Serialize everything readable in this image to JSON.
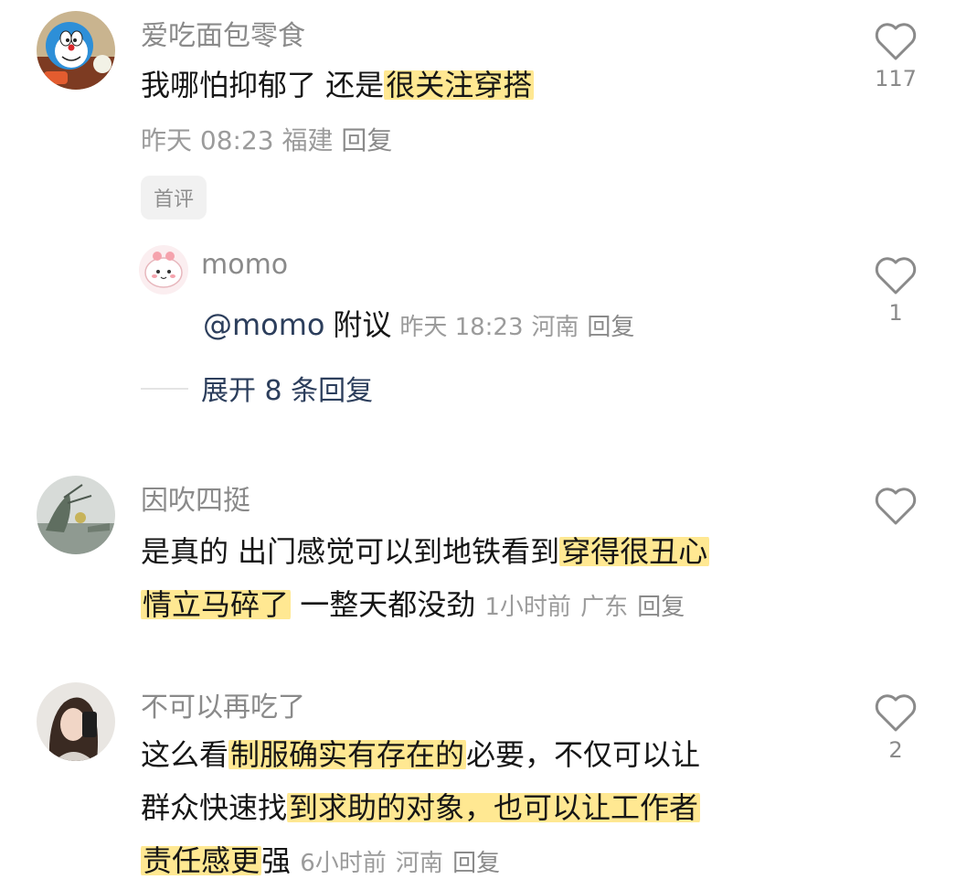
{
  "comments": [
    {
      "username": "爱吃面包零食",
      "text_plain": "我哪怕抑郁了 还是",
      "text_hl": "很关注穿搭",
      "time": "昨天 08:23",
      "location": "福建",
      "reply_label": "回复",
      "badge": "首评",
      "likes": "117",
      "avatar_icon": "doraemon-avatar-icon"
    },
    {
      "username": "因吹四挺",
      "line1_plain": "是真的 出门感觉可以到地铁看到",
      "line1_hl": "穿得很丑心",
      "line2_hl": "情立马碎了",
      "line2_plain": " 一整天都没劲",
      "time": "1小时前",
      "location": "广东",
      "reply_label": "回复",
      "likes": "",
      "avatar_icon": "landscape-avatar-icon"
    },
    {
      "username": "不可以再吃了",
      "line1_plain": "这么看",
      "line1_hl": "制服确实有存在的",
      "line1_tail": "必要，不仅可以让",
      "line2_plain": "群众快速找",
      "line2_hl": "到求助的对象，也可以让工作者",
      "line3_hl": "责任感更",
      "line3_plain": "强",
      "time": "6小时前",
      "location": "河南",
      "reply_label": "回复",
      "likes": "2",
      "avatar_icon": "selfie-avatar-icon"
    }
  ],
  "reply": {
    "username": "momo",
    "mention": "@momo",
    "text": "附议",
    "time": "昨天 18:23",
    "location": "河南",
    "reply_label": "回复",
    "likes": "1",
    "avatar_icon": "pink-cartoon-avatar-icon"
  },
  "expand": {
    "label": "展开 8 条回复"
  },
  "colors": {
    "highlight": "#ffe06e",
    "link": "#2c3e5c",
    "meta": "#9b9b9b"
  }
}
